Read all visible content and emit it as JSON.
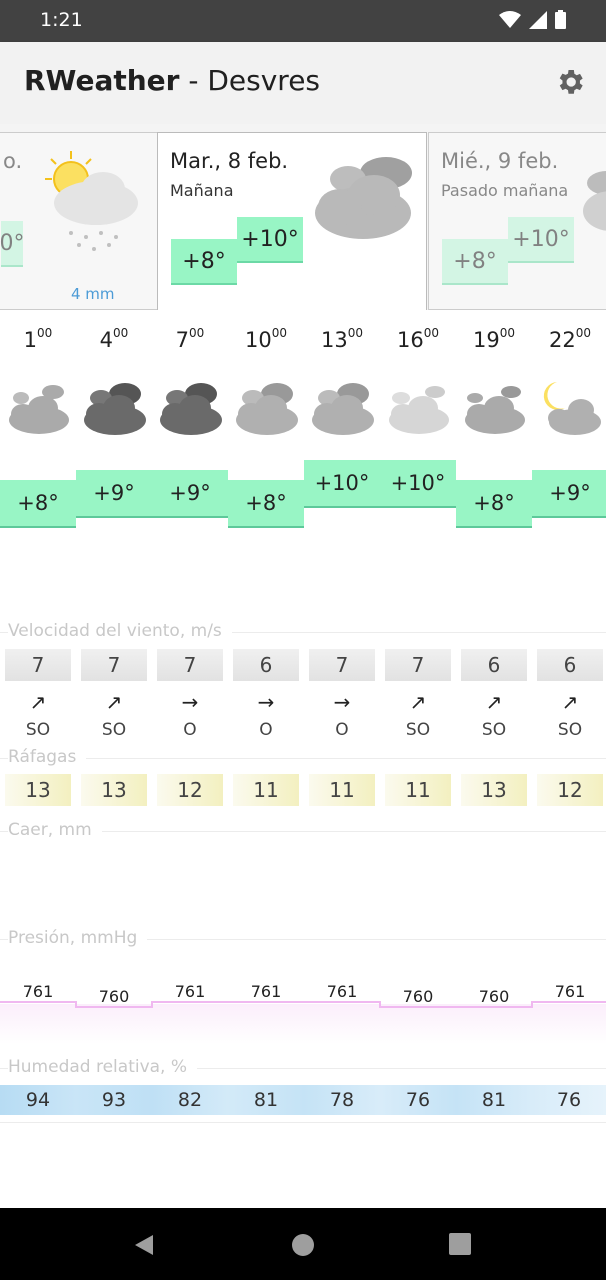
{
  "status": {
    "time": "1:21"
  },
  "app": {
    "title_bold": "RWeather",
    "title_rest": " - Desvres"
  },
  "days": [
    {
      "date": "o.",
      "sub": "",
      "t_low": "",
      "t_high": "0°",
      "precip": "4 mm"
    },
    {
      "date": "Mar., 8 feb.",
      "sub": "Mañana",
      "t_low": "+8°",
      "t_high": "+10°"
    },
    {
      "date": "Mié., 9 feb.",
      "sub": "Pasado mañana",
      "t_low": "+8°",
      "t_high": "+10°"
    }
  ],
  "hours": [
    {
      "h": "1",
      "m": "00",
      "temp": "+8°"
    },
    {
      "h": "4",
      "m": "00",
      "temp": "+9°"
    },
    {
      "h": "7",
      "m": "00",
      "temp": "+9°"
    },
    {
      "h": "10",
      "m": "00",
      "temp": "+8°"
    },
    {
      "h": "13",
      "m": "00",
      "temp": "+10°"
    },
    {
      "h": "16",
      "m": "00",
      "temp": "+10°"
    },
    {
      "h": "19",
      "m": "00",
      "temp": "+8°"
    },
    {
      "h": "22",
      "m": "00",
      "temp": "+9°"
    }
  ],
  "wind": {
    "label": "Velocidad del viento, m/s",
    "speeds": [
      "7",
      "7",
      "7",
      "6",
      "7",
      "7",
      "6",
      "6"
    ],
    "arrows": [
      "↗",
      "↗",
      "→",
      "→",
      "→",
      "↗",
      "↗",
      "↗"
    ],
    "dirs": [
      "SO",
      "SO",
      "O",
      "O",
      "O",
      "SO",
      "SO",
      "SO"
    ]
  },
  "gusts": {
    "label": "Ráfagas",
    "values": [
      "13",
      "13",
      "12",
      "11",
      "11",
      "11",
      "13",
      "12"
    ]
  },
  "precip": {
    "label": "Caer, mm"
  },
  "pressure": {
    "label": "Presión, mmHg",
    "values": [
      "761",
      "760",
      "761",
      "761",
      "761",
      "760",
      "760",
      "761"
    ]
  },
  "humidity": {
    "label": "Humedad relativa, %",
    "values": [
      "94",
      "93",
      "82",
      "81",
      "78",
      "76",
      "81",
      "76"
    ]
  },
  "colors": {
    "temp_fill": "#98f5c5",
    "gust_fill": "#f5f3c4",
    "hum_fill": "#c5e3f6",
    "press_line": "#f0b8f0"
  }
}
